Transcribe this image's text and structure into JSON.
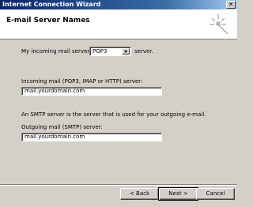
{
  "window": {
    "title": "Internet Connection Wizard"
  },
  "header": {
    "title": "E-mail Server Names"
  },
  "incoming_type": {
    "prefix": "My incoming mail server is a",
    "selected": "POP3",
    "suffix": "server."
  },
  "incoming": {
    "label": "Incoming mail (POP3, IMAP or HTTP) server:",
    "value": "mail.yourdomain.com"
  },
  "smtp_note": "An SMTP server is the server that is used for your outgoing e-mail.",
  "outgoing": {
    "label": "Outgoing mail (SMTP) server:",
    "value": "mail.yourdomain.com"
  },
  "buttons": {
    "back": "< Back",
    "next": "Next >",
    "cancel": "Cancel"
  },
  "icons": {
    "close": "close-icon",
    "wizard": "wizard-sparkle-icon",
    "dropdown": "chevron-down-icon"
  }
}
